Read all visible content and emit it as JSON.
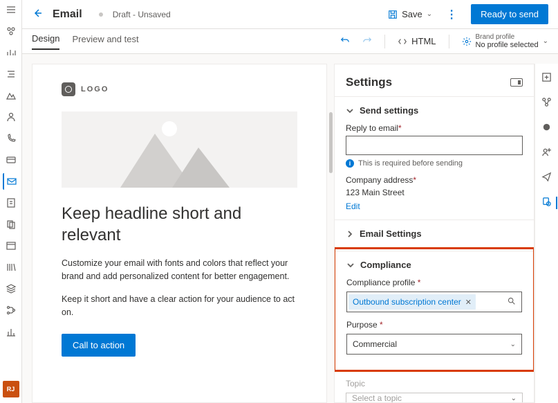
{
  "header": {
    "title": "Email",
    "draft": "Draft - Unsaved",
    "save": "Save",
    "ready": "Ready to send"
  },
  "bar": {
    "tab_design": "Design",
    "tab_preview": "Preview and test",
    "html": "HTML",
    "brand_label": "Brand profile",
    "brand_value": "No profile selected"
  },
  "canvas": {
    "logo": "LOGO",
    "headline": "Keep headline short and relevant",
    "body1": "Customize your email with fonts and colors that reflect your brand and add personalized content for better engagement.",
    "body2": "Keep it short and have a clear action for your audience to act on.",
    "cta": "Call to action"
  },
  "settings": {
    "title": "Settings",
    "send": {
      "title": "Send settings",
      "reply_label": "Reply to email",
      "reply_value": "",
      "info": "This is required before sending",
      "company_label": "Company address",
      "company_value": "123 Main Street",
      "edit": "Edit"
    },
    "email_settings": "Email Settings",
    "compliance": {
      "title": "Compliance",
      "profile_label": "Compliance profile ",
      "profile_value": "Outbound subscription center",
      "purpose_label": "Purpose ",
      "purpose_value": "Commercial"
    },
    "topic": {
      "label": "Topic",
      "placeholder": "Select a topic"
    }
  },
  "avatar": "RJ"
}
